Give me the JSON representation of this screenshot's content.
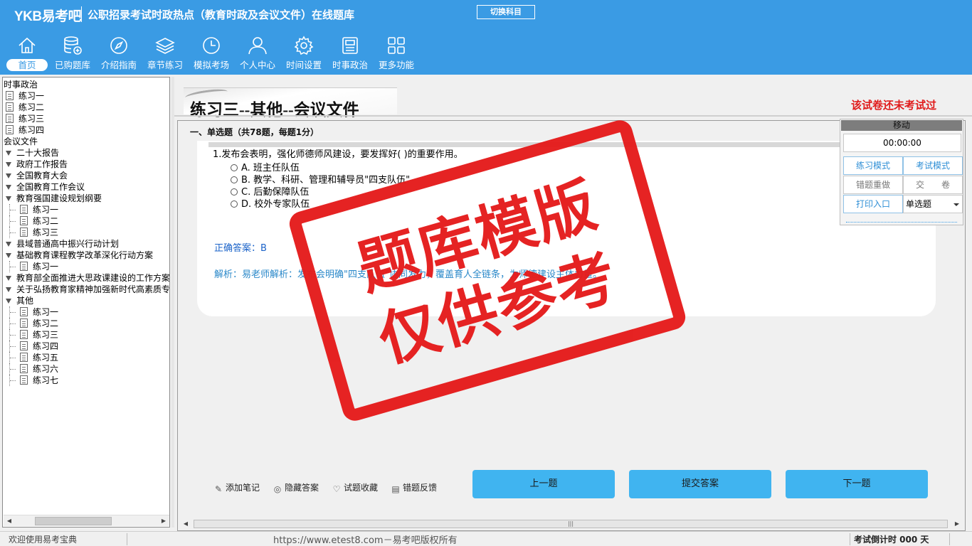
{
  "header": {
    "logo": "YKB易考吧",
    "title": "公职招录考试时政热点（教育时政及会议文件）在线题库",
    "switch_subject": "切换科目"
  },
  "nav": [
    {
      "label": "首页",
      "icon": "home-icon"
    },
    {
      "label": "已购题库",
      "icon": "database-icon"
    },
    {
      "label": "介绍指南",
      "icon": "compass-icon"
    },
    {
      "label": "章节练习",
      "icon": "layers-icon"
    },
    {
      "label": "模拟考场",
      "icon": "clock-icon"
    },
    {
      "label": "个人中心",
      "icon": "user-icon"
    },
    {
      "label": "时间设置",
      "icon": "gear-icon"
    },
    {
      "label": "时事政治",
      "icon": "news-icon"
    },
    {
      "label": "更多功能",
      "icon": "grid-icon"
    }
  ],
  "tree": [
    {
      "label": "时事政治",
      "level": 0,
      "kind": "root"
    },
    {
      "label": "练习一",
      "level": 1,
      "kind": "doc"
    },
    {
      "label": "练习二",
      "level": 1,
      "kind": "doc"
    },
    {
      "label": "练习三",
      "level": 1,
      "kind": "doc"
    },
    {
      "label": "练习四",
      "level": 1,
      "kind": "doc"
    },
    {
      "label": "会议文件",
      "level": 0,
      "kind": "root"
    },
    {
      "label": "二十大报告",
      "level": 1,
      "kind": "folder"
    },
    {
      "label": "政府工作报告",
      "level": 1,
      "kind": "folder"
    },
    {
      "label": "全国教育大会",
      "level": 1,
      "kind": "folder"
    },
    {
      "label": "全国教育工作会议",
      "level": 1,
      "kind": "folder"
    },
    {
      "label": "教育强国建设规划纲要",
      "level": 1,
      "kind": "folder"
    },
    {
      "label": "练习一",
      "level": 2,
      "kind": "doc"
    },
    {
      "label": "练习二",
      "level": 2,
      "kind": "doc"
    },
    {
      "label": "练习三",
      "level": 2,
      "kind": "doc"
    },
    {
      "label": "县域普通高中振兴行动计划",
      "level": 1,
      "kind": "folder"
    },
    {
      "label": "基础教育课程教学改革深化行动方案",
      "level": 1,
      "kind": "folder"
    },
    {
      "label": "练习一",
      "level": 2,
      "kind": "doc"
    },
    {
      "label": "教育部全面推进大思政课建设的工作方案",
      "level": 1,
      "kind": "folder"
    },
    {
      "label": "关于弘扬教育家精神加强新时代高素质专业化教师队伍建设的意见",
      "level": 1,
      "kind": "folder"
    },
    {
      "label": "其他",
      "level": 1,
      "kind": "folder"
    },
    {
      "label": "练习一",
      "level": 2,
      "kind": "doc"
    },
    {
      "label": "练习二",
      "level": 2,
      "kind": "doc"
    },
    {
      "label": "练习三",
      "level": 2,
      "kind": "doc"
    },
    {
      "label": "练习四",
      "level": 2,
      "kind": "doc"
    },
    {
      "label": "练习五",
      "level": 2,
      "kind": "doc"
    },
    {
      "label": "练习六",
      "level": 2,
      "kind": "doc"
    },
    {
      "label": "练习七",
      "level": 2,
      "kind": "doc"
    }
  ],
  "exam": {
    "title": "练习三--其他--会议文件",
    "not_taken": "该试卷还未考试过",
    "section": "一、单选题（共78题，每题1分）",
    "question": "1.发布会表明，强化师德师风建设，要发挥好( )的重要作用。",
    "options": [
      "A. 班主任队伍",
      "B. 教学、科研、管理和辅导员\"四支队伍\"",
      "C. 后勤保障队伍",
      "D. 校外专家队伍"
    ],
    "answer": "正确答案：B",
    "analysis": "解析：易老师解析：发布会明确\"四支队伍\"协同发力，覆盖育人全链条，为师德建设主体力量。"
  },
  "tools": {
    "add_note": "添加笔记",
    "hide_answer": "隐藏答案",
    "favorite": "试题收藏",
    "feedback": "错题反馈"
  },
  "buttons": {
    "prev": "上一题",
    "submit": "提交答案",
    "next": "下一题"
  },
  "panel": {
    "move": "移动",
    "timer": "00:00:00",
    "practice_mode": "练习模式",
    "exam_mode": "考试模式",
    "redo_wrong": "错题重做",
    "hand_in": "交　　卷",
    "print": "打印入口",
    "question_type": "单选题"
  },
  "watermark": {
    "line1": "题库模版",
    "line2": "仅供参考"
  },
  "status": {
    "welcome": "欢迎使用易考宝典",
    "copyright": "https://www.etest8.com－易考吧版权所有",
    "countdown": "考试倒计时 000 天"
  },
  "colors": {
    "brand": "#3a9be4",
    "button": "#40b4f0",
    "warning": "#e01b1b",
    "answer": "#1b63c9"
  }
}
